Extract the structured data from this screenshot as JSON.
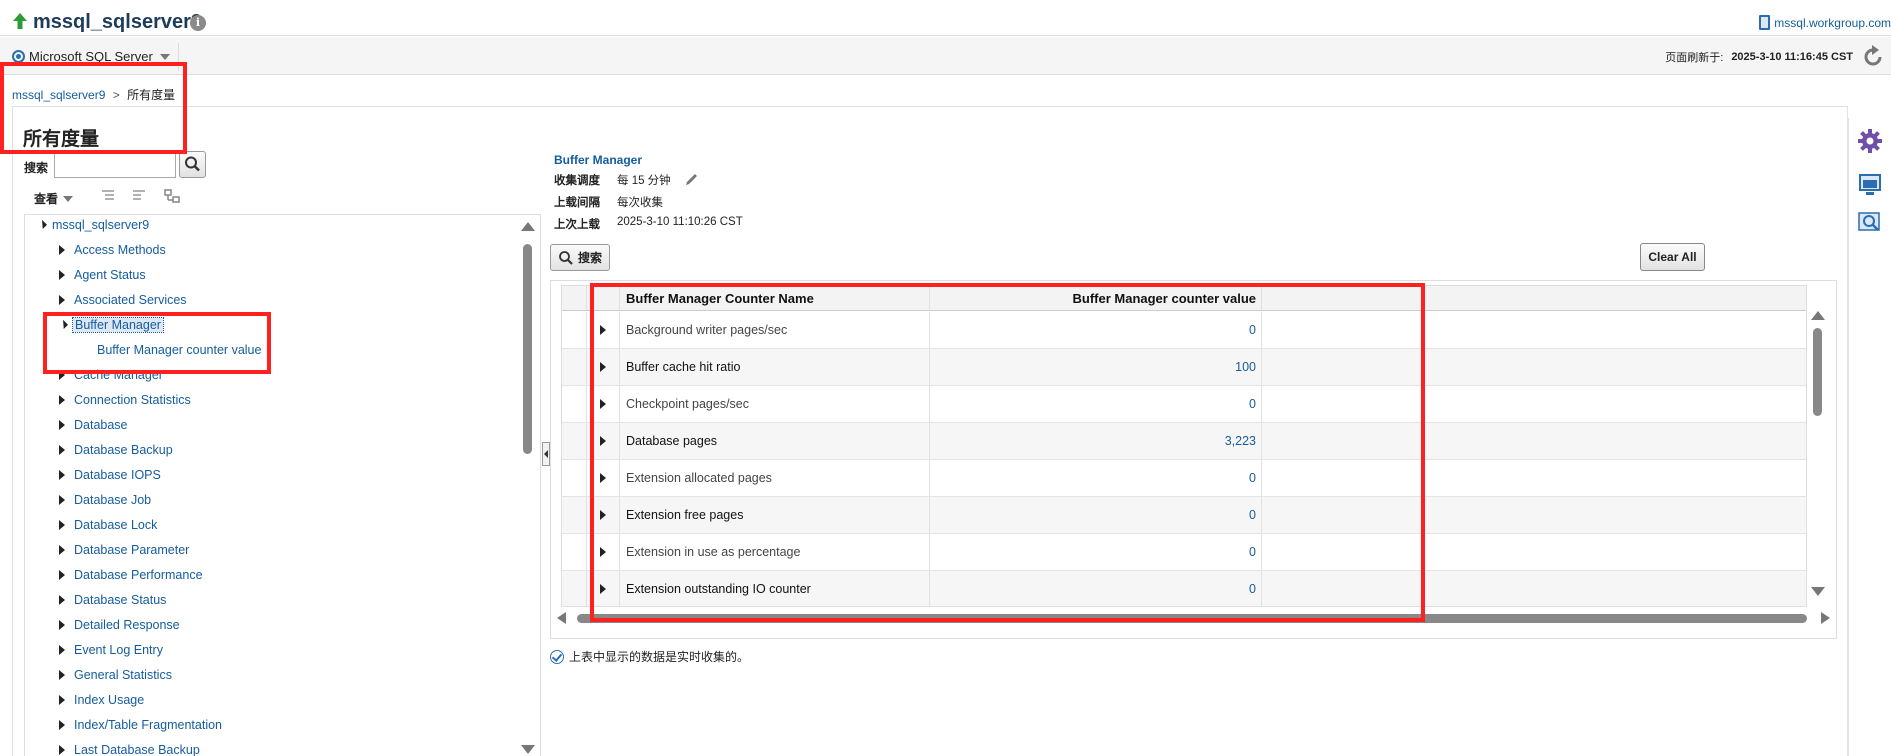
{
  "header": {
    "target_name": "mssql_sqlserver9",
    "host_link": "mssql.workgroup.com"
  },
  "menubar": {
    "target_menu": "Microsoft SQL Server",
    "refresh_label": "页面刷新于:",
    "refresh_time": "2025-3-10 11:16:45 CST"
  },
  "breadcrumb": {
    "parent": "mssql_sqlserver9",
    "separator": ">",
    "current": "所有度量"
  },
  "page_title": "所有度量",
  "left_pane": {
    "search_label": "搜索",
    "view_menu": "查看",
    "tree": {
      "root": "mssql_sqlserver9",
      "items": [
        "Access Methods",
        "Agent Status",
        "Associated Services",
        "Buffer Manager",
        "Buffer Manager counter value",
        "Cache Manager",
        "Connection Statistics",
        "Database",
        "Database Backup",
        "Database IOPS",
        "Database Job",
        "Database Lock",
        "Database Parameter",
        "Database Performance",
        "Database Status",
        "Detailed Response",
        "Event Log Entry",
        "General Statistics",
        "Index Usage",
        "Index/Table Fragmentation",
        "Last Database Backup"
      ]
    }
  },
  "metric_detail": {
    "title": "Buffer Manager",
    "rows": [
      {
        "label": "收集调度",
        "value": "每 15 分钟"
      },
      {
        "label": "上载间隔",
        "value": "每次收集"
      },
      {
        "label": "上次上载",
        "value": "2025-3-10 11:10:26 CST"
      }
    ],
    "search_button": "搜索",
    "clear_all_button": "Clear All"
  },
  "table": {
    "columns": [
      "Buffer Manager Counter Name",
      "Buffer Manager counter value"
    ],
    "rows": [
      {
        "name": "Background writer pages/sec",
        "value": "0"
      },
      {
        "name": "Buffer cache hit ratio",
        "value": "100"
      },
      {
        "name": "Checkpoint pages/sec",
        "value": "0"
      },
      {
        "name": "Database pages",
        "value": "3,223"
      },
      {
        "name": "Extension allocated pages",
        "value": "0"
      },
      {
        "name": "Extension free pages",
        "value": "0"
      },
      {
        "name": "Extension in use as percentage",
        "value": "0"
      },
      {
        "name": "Extension outstanding IO counter",
        "value": "0"
      }
    ]
  },
  "footer_note": "上表中显示的数据是实时收集的。",
  "colors": {
    "link": "#145c9e",
    "annotation": "#ff2020",
    "up_arrow": "#2e9b3a"
  },
  "icons": [
    "up-arrow-icon",
    "info-icon",
    "server-icon",
    "refresh-icon",
    "search-icon",
    "pencil-icon",
    "check-icon",
    "gear-icon",
    "monitor-icon",
    "magnifier-icon"
  ]
}
